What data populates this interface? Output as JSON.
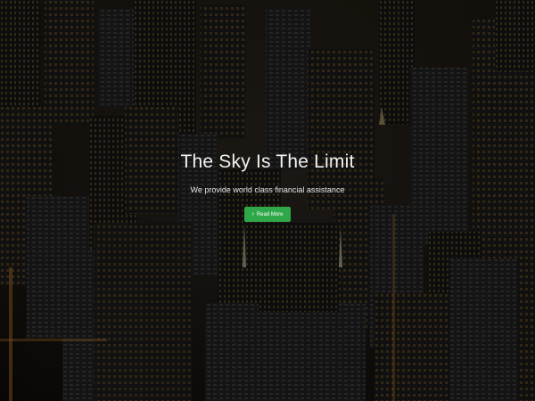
{
  "hero": {
    "title": "The Sky Is The Limit",
    "subtitle": "We provide world class financial assistance",
    "button_label": "Read More",
    "button_icon": "chevron-right-icon",
    "button_color": "#2fa84a"
  }
}
